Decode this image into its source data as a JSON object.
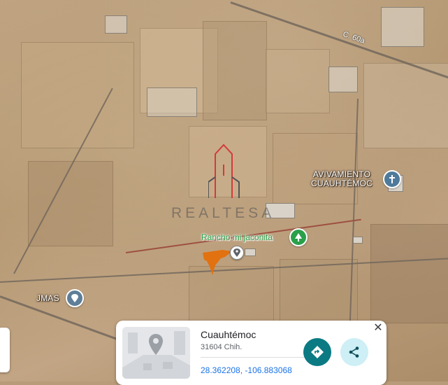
{
  "map": {
    "road_label": "C. 60a",
    "places": [
      {
        "name": "AVIVAMIENTO\nCUAUHTÉMOC",
        "icon": "church-icon"
      },
      {
        "name": "Rancho mi jaconita",
        "icon": "tree-icon"
      },
      {
        "name": "JMAS",
        "icon": "pin-icon"
      }
    ],
    "watermark": "REALTESA"
  },
  "card": {
    "title": "Cuauhtémoc",
    "subtitle": "31604 Chih.",
    "coordinates": "28.362208, -106.883068",
    "close_label": "✕",
    "directions_icon": "directions-icon",
    "share_icon": "share-icon"
  },
  "colors": {
    "accent_teal": "#0b7a83",
    "share_bg": "#cdeff5",
    "marker_orange": "#e46f0b",
    "place_green": "#2aa04a",
    "link_blue": "#1a73e8"
  }
}
